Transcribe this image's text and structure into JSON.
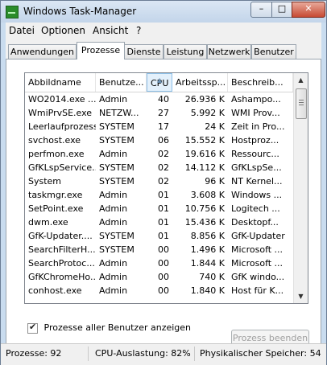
{
  "window": {
    "title": "Windows Task-Manager",
    "buttons": {
      "minimize": "–",
      "maximize": "□",
      "close": "✕"
    }
  },
  "menu": [
    "Datei",
    "Optionen",
    "Ansicht",
    "?"
  ],
  "tabs": [
    "Anwendungen",
    "Prozesse",
    "Dienste",
    "Leistung",
    "Netzwerk",
    "Benutzer"
  ],
  "active_tab": "Prozesse",
  "table": {
    "columns": [
      "Abbildname",
      "Benutze...",
      "CPU",
      "Arbeitssp...",
      "Beschreib..."
    ],
    "sorted_column": "CPU",
    "rows": [
      [
        "WO2014.exe ...",
        "Admin",
        "40",
        "26.936 K",
        "Ashampo..."
      ],
      [
        "WmiPrvSE.exe",
        "NETZW...",
        "27",
        "5.992 K",
        "WMI Prov..."
      ],
      [
        "Leerlaufprozess",
        "SYSTEM",
        "17",
        "24 K",
        "Zeit in Pro..."
      ],
      [
        "svchost.exe",
        "SYSTEM",
        "06",
        "15.552 K",
        "Hostproz..."
      ],
      [
        "perfmon.exe",
        "Admin",
        "02",
        "19.616 K",
        "Ressourc..."
      ],
      [
        "GfKLspService...",
        "SYSTEM",
        "02",
        "14.112 K",
        "GfKLspSe..."
      ],
      [
        "System",
        "SYSTEM",
        "02",
        "96 K",
        "NT Kernel..."
      ],
      [
        "taskmgr.exe",
        "Admin",
        "01",
        "3.608 K",
        "Windows ..."
      ],
      [
        "SetPoint.exe",
        "Admin",
        "01",
        "10.756 K",
        "Logitech ..."
      ],
      [
        "dwm.exe",
        "Admin",
        "01",
        "15.436 K",
        "Desktopf..."
      ],
      [
        "GfK-Updater....",
        "SYSTEM",
        "01",
        "8.856 K",
        "GfK-Updater"
      ],
      [
        "SearchFilterH...",
        "SYSTEM",
        "00",
        "1.496 K",
        "Microsoft ..."
      ],
      [
        "SearchProtoc...",
        "Admin",
        "00",
        "1.844 K",
        "Microsoft ..."
      ],
      [
        "GfKChromeHo...",
        "Admin",
        "00",
        "740 K",
        "GfK windo..."
      ],
      [
        "conhost.exe",
        "Admin",
        "00",
        "1.840 K",
        "Host für K..."
      ]
    ]
  },
  "show_all_users": {
    "label": "Prozesse aller Benutzer anzeigen",
    "checked": true
  },
  "end_process_button": "Prozess beenden",
  "status": {
    "processes": "Prozesse: 92",
    "cpu": "CPU-Auslastung: 82%",
    "memory": "Physikalischer Speicher: 54"
  }
}
